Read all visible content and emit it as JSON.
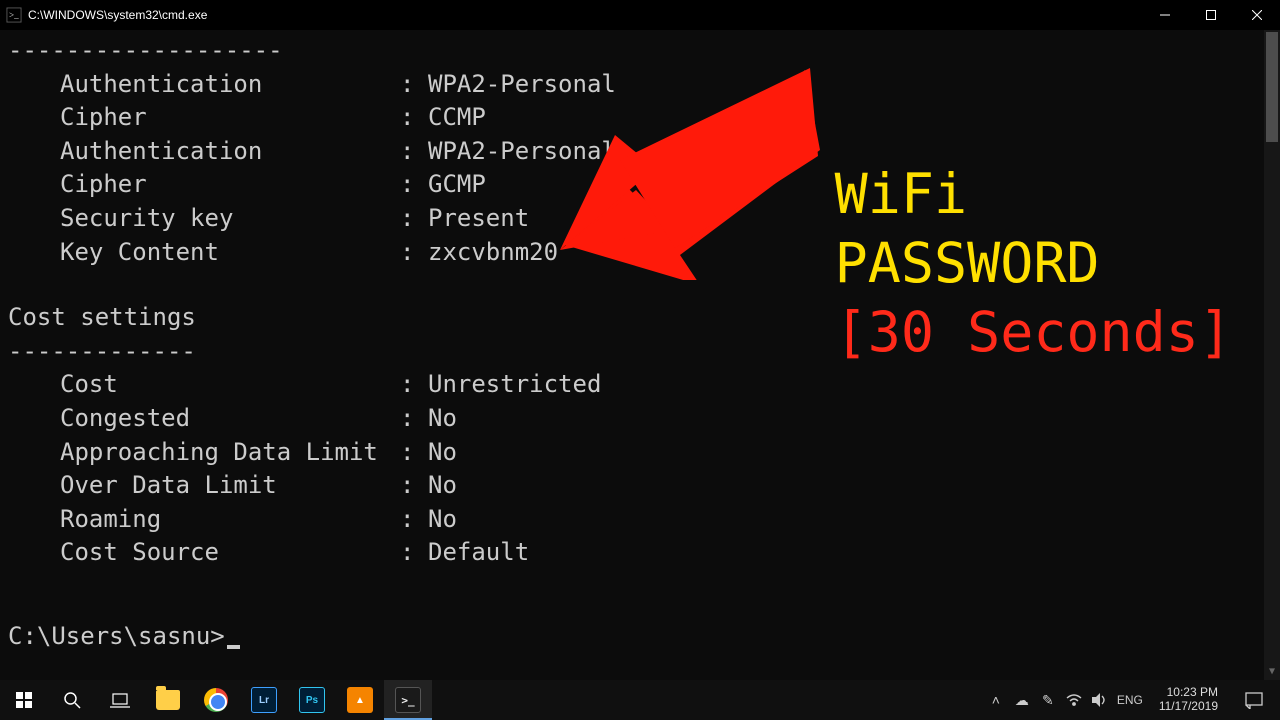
{
  "window": {
    "title": "C:\\WINDOWS\\system32\\cmd.exe",
    "icon": "cmd-icon"
  },
  "terminal": {
    "divider1": "-------------------",
    "security": [
      {
        "key": "Authentication",
        "value": "WPA2-Personal"
      },
      {
        "key": "Cipher",
        "value": "CCMP"
      },
      {
        "key": "Authentication",
        "value": "WPA2-Personal"
      },
      {
        "key": "Cipher",
        "value": "GCMP"
      },
      {
        "key": "Security key",
        "value": "Present"
      },
      {
        "key": "Key Content",
        "value": "zxcvbnm20"
      }
    ],
    "section_heading": "Cost settings",
    "divider2": "-------------",
    "cost": [
      {
        "key": "Cost",
        "value": "Unrestricted"
      },
      {
        "key": "Congested",
        "value": "No"
      },
      {
        "key": "Approaching Data Limit",
        "value": "No"
      },
      {
        "key": "Over Data Limit",
        "value": "No"
      },
      {
        "key": "Roaming",
        "value": "No"
      },
      {
        "key": "Cost Source",
        "value": "Default"
      }
    ],
    "prompt": "C:\\Users\\sasnu>"
  },
  "overlay": {
    "line1": "WiFi",
    "line2": "PASSWORD",
    "line3": "[30 Seconds]"
  },
  "taskbar": {
    "apps": [
      "start",
      "search",
      "task-view",
      "explorer",
      "chrome",
      "lightroom",
      "photoshop",
      "vlc",
      "cmd"
    ],
    "tray": {
      "chevron": "˄",
      "lang": "ENG",
      "time": "10:23 PM",
      "date": "11/17/2019"
    }
  },
  "colors": {
    "overlay_yellow": "#ffe000",
    "overlay_red": "#ff2a1a",
    "terminal_bg": "#0c0c0c",
    "terminal_fg": "#cccccc"
  }
}
